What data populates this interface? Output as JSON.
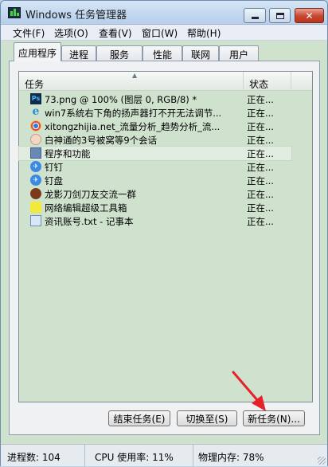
{
  "window": {
    "title": "Windows 任务管理器"
  },
  "menu": [
    {
      "id": "file",
      "label": "文件(F)"
    },
    {
      "id": "options",
      "label": "选项(O)"
    },
    {
      "id": "view",
      "label": "查看(V)"
    },
    {
      "id": "window",
      "label": "窗口(W)"
    },
    {
      "id": "help",
      "label": "帮助(H)"
    }
  ],
  "tabs": [
    {
      "id": "applications",
      "label": "应用程序",
      "active": true
    },
    {
      "id": "processes",
      "label": "进程"
    },
    {
      "id": "services",
      "label": "服务"
    },
    {
      "id": "performance",
      "label": "性能"
    },
    {
      "id": "networking",
      "label": "联网"
    },
    {
      "id": "users",
      "label": "用户"
    }
  ],
  "list": {
    "columns": {
      "task": "任务",
      "status": "状态"
    },
    "rows": [
      {
        "icon": "photoshop-icon",
        "name": "73.png @ 100% (图层 0, RGB/8) *",
        "status": "正在..."
      },
      {
        "icon": "ie-icon",
        "name": "win7系统右下角的扬声器打不开无法调节...",
        "status": "正在..."
      },
      {
        "icon": "chrome-icon",
        "name": "xitongzhijia.net_流量分析_趋势分析_流...",
        "status": "正在..."
      },
      {
        "icon": "chat-app-icon",
        "name": "白神通的3号被窝等9个会话",
        "status": "正在..."
      },
      {
        "icon": "programs-features-icon",
        "name": "程序和功能",
        "status": "正在...",
        "selected": true
      },
      {
        "icon": "dingtalk-icon",
        "name": "钉钉",
        "status": "正在..."
      },
      {
        "icon": "dingpan-icon",
        "name": "钉盘",
        "status": "正在..."
      },
      {
        "icon": "group-avatar-icon",
        "name": "龙影刀剑刀友交流一群",
        "status": "正在..."
      },
      {
        "icon": "editor-tool-icon",
        "name": "网络编辑超级工具箱",
        "status": "正在..."
      },
      {
        "icon": "notepad-icon",
        "name": "资讯账号.txt - 记事本",
        "status": "正在..."
      }
    ]
  },
  "buttons": {
    "end_task": "结束任务(E)",
    "switch_to": "切换至(S)",
    "new_task": "新任务(N)..."
  },
  "status_bar": {
    "processes": "进程数: 104",
    "cpu": "CPU 使用率: 11%",
    "memory": "物理内存: 78%"
  },
  "colors": {
    "annotation_arrow": "#e8202a",
    "list_background": "#cfe2ce"
  }
}
